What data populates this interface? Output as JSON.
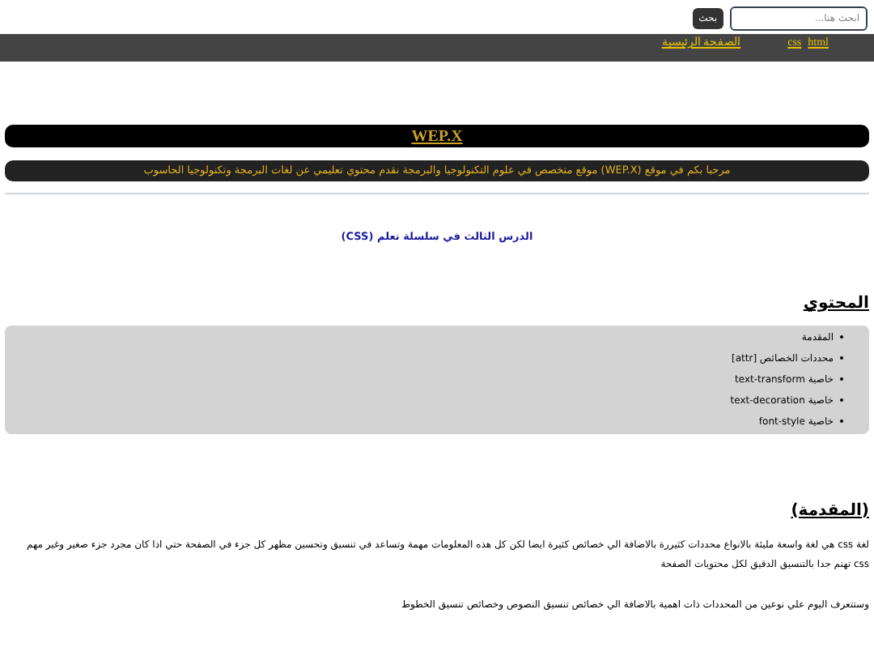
{
  "search": {
    "placeholder": "ابحث هنا...",
    "button": "بحث"
  },
  "nav": {
    "links": [
      "html",
      "css",
      "الصفحة الرئيسية"
    ]
  },
  "banner": {
    "title": "WEP.X",
    "welcome": "مرحبا بكم في موقع (WEP.X) موقع متخصص في علوم التكنولوجيا والبرمجة نقدم محتوي تعليمي عن لغات البرمجة وتكنولوجيا الحاسوب"
  },
  "lesson_title": "الدرس الثالث في سلسلة تعلم (CSS)",
  "contents": {
    "heading": "المحتوي",
    "items": [
      "المقدمة",
      "محددات الخصائص [attr]",
      "خاصية text-transform",
      "خاصية text-decoration",
      "خاصية font-style"
    ]
  },
  "intro": {
    "heading": "(المقدمة)",
    "paragraphs": [
      "لغة css هي لغة واسعة مليئة بالانواع محددات كثيررة بالاضافة الي خصائص كثيرة ايضا لكن كل هذه المعلومات مهمة وتساعد في تنسيق وتحسين مظهر كل جزء في الصفحة حتي اذا كان مجرد جزء صغير وغير مهم css تهتم جدا بالتنسيق الدقيق لكل محتويات الصفحة",
      "وستتعرف اليوم علي نوعين من المحددات ذات اهمية بالاضافة الي خصائص تنسيق النصوص وخصائص تنسيق الخطوط"
    ]
  }
}
